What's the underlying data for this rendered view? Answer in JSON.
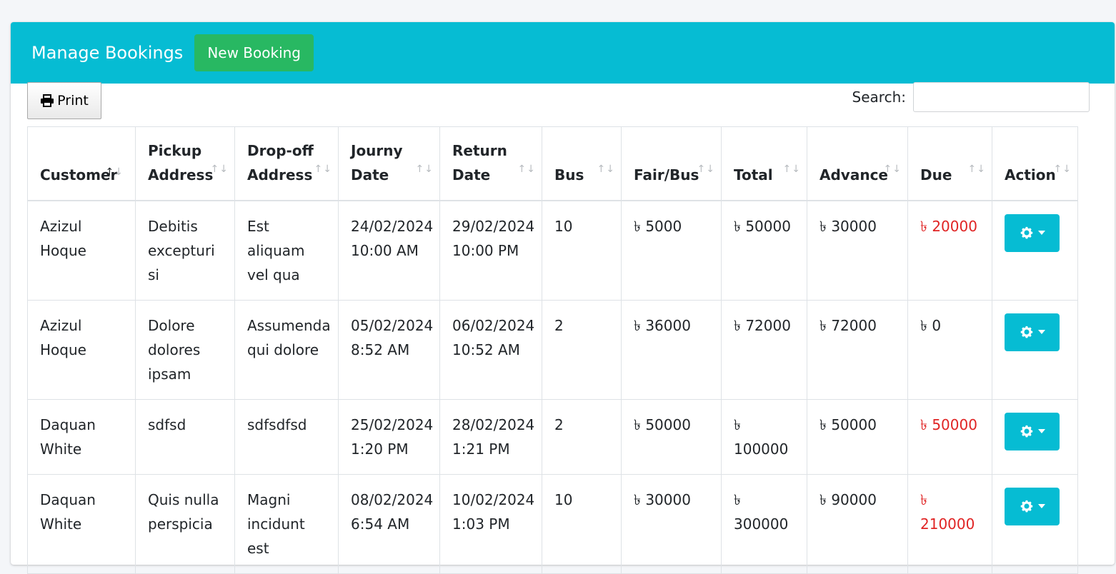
{
  "header": {
    "title": "Manage Bookings",
    "new_booking_label": "New Booking",
    "accent_color": "#06bcd3",
    "success_color": "#28b862"
  },
  "toolbar": {
    "print_label": "Print",
    "print_icon": "print-icon",
    "search_label": "Search:",
    "search_value": ""
  },
  "table": {
    "columns": [
      {
        "line1": "Customer",
        "line2": ""
      },
      {
        "line1": "Pickup",
        "line2": "Address"
      },
      {
        "line1": "Drop-off",
        "line2": "Address"
      },
      {
        "line1": "Journy",
        "line2": "Date"
      },
      {
        "line1": "Return",
        "line2": "Date"
      },
      {
        "line1": "Bus",
        "line2": ""
      },
      {
        "line1": "Fair/Bus",
        "line2": ""
      },
      {
        "line1": "Total",
        "line2": ""
      },
      {
        "line1": "Advance",
        "line2": ""
      },
      {
        "line1": "Due",
        "line2": ""
      },
      {
        "line1": "Action",
        "line2": ""
      }
    ],
    "rows": [
      {
        "customer": "Azizul Hoque",
        "pickup": "Debitis excepturi si",
        "dropoff": "Est aliquam vel qua",
        "journey_date": "24/02/2024",
        "journey_time": "10:00 AM",
        "return_date": "29/02/2024",
        "return_time": "10:00 PM",
        "bus": "10",
        "fair": "৳ 5000",
        "total": "৳ 50000",
        "advance": "৳ 30000",
        "due": "৳ 20000"
      },
      {
        "customer": "Azizul Hoque",
        "pickup": "Dolore dolores ipsam",
        "dropoff": "Assumenda qui dolore",
        "journey_date": "05/02/2024",
        "journey_time": "8:52 AM",
        "return_date": "06/02/2024",
        "return_time": "10:52 AM",
        "bus": "2",
        "fair": "৳ 36000",
        "total": "৳ 72000",
        "advance": "৳ 72000",
        "due": "৳ 0"
      },
      {
        "customer": "Daquan White",
        "pickup": "sdfsd",
        "dropoff": "sdfsdfsd",
        "journey_date": "25/02/2024",
        "journey_time": "1:20 PM",
        "return_date": "28/02/2024",
        "return_time": "1:21 PM",
        "bus": "2",
        "fair": "৳ 50000",
        "total": "৳ 100000",
        "advance": "৳ 50000",
        "due": "৳ 50000"
      },
      {
        "customer": "Daquan White",
        "pickup": "Quis nulla perspicia",
        "dropoff": "Magni incidunt est",
        "journey_date": "08/02/2024",
        "journey_time": "6:54 AM",
        "return_date": "10/02/2024",
        "return_time": "1:03 PM",
        "bus": "10",
        "fair": "৳ 30000",
        "total": "৳ 300000",
        "advance": "৳ 90000",
        "due": "৳ 210000"
      }
    ],
    "action_icon": "gear-icon",
    "due_positive_color": "#e02424"
  }
}
